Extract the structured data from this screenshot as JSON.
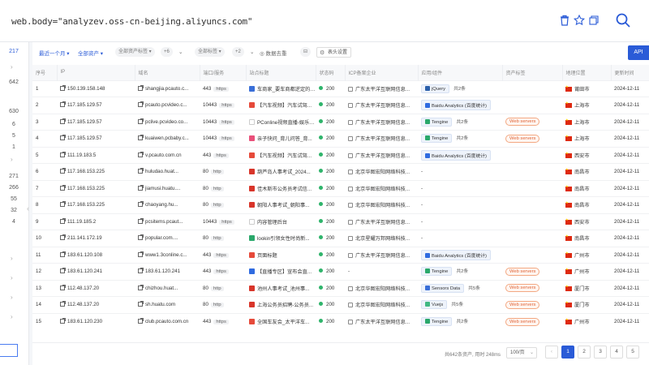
{
  "query": "web.body=\"analyzev.oss-cn-beijing.aliyuncs.com\"",
  "sidebar": {
    "numbers_top": [
      "217"
    ],
    "numbers_mid": [
      "642",
      "",
      "630",
      "6",
      "5",
      "1"
    ],
    "numbers_low": [
      "271",
      "266",
      "55",
      "32",
      "4"
    ]
  },
  "filters": {
    "time": "最近一个月",
    "assets": "全部资产",
    "asset_tag": "全部资产标签",
    "asset_tag_count": "+6",
    "component_tag": "全部标签",
    "component_tag_count": "+2",
    "stat": "数据去重",
    "settings": "表头设置",
    "api": "API"
  },
  "table": {
    "headers": [
      "序号",
      "IP",
      "域名",
      "端口/服务",
      "站点标题",
      "状态码",
      "ICP备案企业",
      "应用/组件",
      "资产标签",
      "地理位置",
      "更新时间"
    ],
    "rows": [
      {
        "n": "1",
        "ip": "150.139.158.148",
        "domain": "shangjia.pcauto.c...",
        "port": "443",
        "proto": "https",
        "title": "车商家_要车商都逆定的网...",
        "fav": "#3a6fd8",
        "status": "200",
        "icp": "广东太平洋互联网信息...",
        "app": "jQuery",
        "app_logo": "#2b5faa",
        "more": "共2条",
        "tag": "",
        "city": "莆田市",
        "date": "2024-12-11"
      },
      {
        "n": "2",
        "ip": "117.185.129.57",
        "domain": "pcauto.pcvideo.c...",
        "port": "10443",
        "proto": "https",
        "title": "【汽车视频】汽车试驾...",
        "fav": "#e64a3a",
        "status": "200",
        "icp": "广东太平洋互联网信息...",
        "app": "Baidu Analytics (百度统计)",
        "app_logo": "#2f6be0",
        "more": "",
        "tag": "",
        "city": "上海市",
        "date": "2024-12-11"
      },
      {
        "n": "3",
        "ip": "117.185.129.57",
        "domain": "pclive.pcvideo.co...",
        "port": "10443",
        "proto": "https",
        "title": "PConline视频直播-娱乐新...",
        "fav": "",
        "status": "200",
        "icp": "广东太平洋互联网信息...",
        "app": "Tengine",
        "app_logo": "#2aa86b",
        "more": "共2条",
        "tag": "Web servers",
        "city": "上海市",
        "date": "2024-12-11"
      },
      {
        "n": "4",
        "ip": "117.185.129.57",
        "domain": "kuaiwen.pcbaby.c...",
        "port": "10443",
        "proto": "https",
        "title": "亲子快问_育儿问答_育...",
        "fav": "#e9507a",
        "status": "200",
        "icp": "广东太平洋互联网信息...",
        "app": "Tengine",
        "app_logo": "#2aa86b",
        "more": "共2条",
        "tag": "Web servers",
        "city": "上海市",
        "date": "2024-12-11"
      },
      {
        "n": "5",
        "ip": "111.19.183.5",
        "domain": "v.pcauto.com.cn",
        "port": "443",
        "proto": "https",
        "title": "【汽车视频】汽车试驾...",
        "fav": "#e64a3a",
        "status": "200",
        "icp": "广东太平洋互联网信息...",
        "app": "Baidu Analytics (百度统计)",
        "app_logo": "#2f6be0",
        "more": "",
        "tag": "",
        "city": "西安市",
        "date": "2024-12-11"
      },
      {
        "n": "6",
        "ip": "117.168.153.225",
        "domain": "huludao.huat...",
        "port": "80",
        "proto": "http",
        "title": "葫芦岛人事考试_2024...",
        "fav": "#d8352a",
        "status": "200",
        "icp": "北京华图宏阳网络科技...",
        "app": "-",
        "app_logo": "",
        "more": "",
        "tag": "",
        "city": "南昌市",
        "date": "2024-12-11"
      },
      {
        "n": "7",
        "ip": "117.168.153.225",
        "domain": "jiamusi.huatu....",
        "port": "80",
        "proto": "http",
        "title": "佳木斯市公务员考试信...",
        "fav": "#d8352a",
        "status": "200",
        "icp": "北京华图宏阳网络科技...",
        "app": "-",
        "app_logo": "",
        "more": "",
        "tag": "",
        "city": "南昌市",
        "date": "2024-12-11"
      },
      {
        "n": "8",
        "ip": "117.168.153.225",
        "domain": "chaoyang.hu...",
        "port": "80",
        "proto": "http",
        "title": "朝阳人事考试_朝阳事...",
        "fav": "#d8352a",
        "status": "200",
        "icp": "北京华图宏阳网络科技...",
        "app": "-",
        "app_logo": "",
        "more": "",
        "tag": "",
        "city": "南昌市",
        "date": "2024-12-11"
      },
      {
        "n": "9",
        "ip": "111.19.185.2",
        "domain": "pcsitems.pcaut...",
        "port": "10443",
        "proto": "https",
        "title": "内容管理后台",
        "fav": "",
        "status": "200",
        "icp": "广东太平洋互联网信息...",
        "app": "-",
        "app_logo": "",
        "more": "",
        "tag": "",
        "city": "西安市",
        "date": "2024-12-11"
      },
      {
        "n": "10",
        "ip": "211.141.172.19",
        "domain": "popular.com....",
        "port": "80",
        "proto": "http",
        "title": "lookin引领女性时尚新...",
        "fav": "#2aa86b",
        "status": "200",
        "icp": "北京星耀万邦网络科技...",
        "app": "-",
        "app_logo": "",
        "more": "",
        "tag": "",
        "city": "南昌市",
        "date": "2024-12-11"
      },
      {
        "n": "11",
        "ip": "183.61.120.108",
        "domain": "www1.3conline.c...",
        "port": "443",
        "proto": "https",
        "title": "页面标题",
        "fav": "#e64a3a",
        "status": "200",
        "icp": "广东太平洋互联网信息...",
        "app": "Baidu Analytics (百度统计)",
        "app_logo": "#2f6be0",
        "more": "",
        "tag": "",
        "city": "广州市",
        "date": "2024-12-11"
      },
      {
        "n": "12",
        "ip": "183.61.120.241",
        "domain": "183.61.120.241",
        "port": "443",
        "proto": "https",
        "title": "【直播专区】宣布会直...",
        "fav": "#2f6be0",
        "status": "200",
        "icp": "-",
        "app": "Tengine",
        "app_logo": "#2aa86b",
        "more": "共2条",
        "tag": "Web servers",
        "city": "广州市",
        "date": "2024-12-11"
      },
      {
        "n": "13",
        "ip": "112.48.137.20",
        "domain": "chizhou.huat...",
        "port": "80",
        "proto": "http",
        "title": "池州人事考试_池州事...",
        "fav": "#d8352a",
        "status": "200",
        "icp": "北京华图宏阳网络科技...",
        "app": "Sensors Data",
        "app_logo": "#3a6fd8",
        "more": "共5条",
        "tag": "Web servers",
        "city": "厦门市",
        "date": "2024-12-11"
      },
      {
        "n": "14",
        "ip": "112.48.137.20",
        "domain": "sh.huatu.com",
        "port": "80",
        "proto": "http",
        "title": "上海公务员招聘-公务员...",
        "fav": "#d8352a",
        "status": "200",
        "icp": "北京华图宏阳网络科技...",
        "app": "Vuejs",
        "app_logo": "#41b883",
        "more": "共5条",
        "tag": "Web servers",
        "city": "厦门市",
        "date": "2024-12-11"
      },
      {
        "n": "15",
        "ip": "183.61.120.230",
        "domain": "club.pcauto.com.cn",
        "port": "443",
        "proto": "https",
        "title": "全国车友会_太平洋车...",
        "fav": "#e64a3a",
        "status": "200",
        "icp": "广东太平洋互联网信息...",
        "app": "Tengine",
        "app_logo": "#2aa86b",
        "more": "共2条",
        "tag": "Web servers",
        "city": "广州市",
        "date": "2024-12-11"
      }
    ]
  },
  "footer": {
    "total": "共642条资产, 用时 248ms",
    "page_size": "100/页",
    "pages": [
      "1",
      "2",
      "3",
      "4",
      "5"
    ],
    "current_page": "1"
  },
  "colors": {
    "accent": "#2a5bd7",
    "status_ok": "#2fb46b",
    "tag_orange": "#e0663a"
  }
}
